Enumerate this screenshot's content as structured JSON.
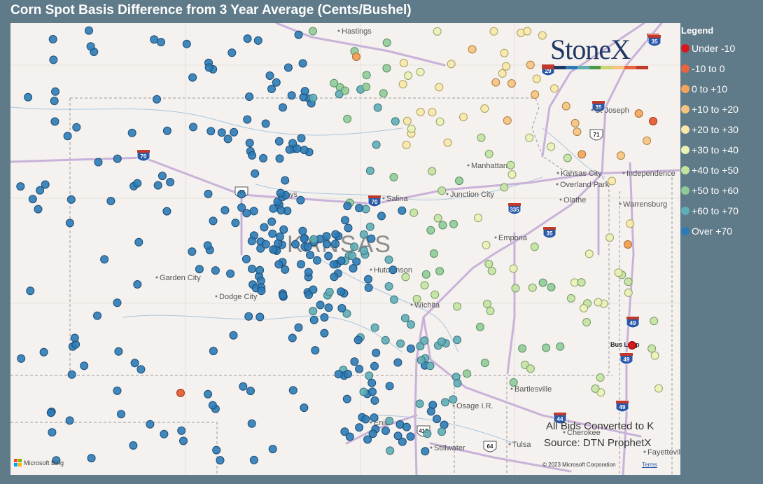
{
  "title": "Corn Spot Basis Difference from 3 Year Average (Cents/Bushel)",
  "legend": {
    "title": "Legend",
    "items": [
      {
        "label": "Under -10",
        "color": "#d7191c"
      },
      {
        "label": "-10 to 0",
        "color": "#e8643c"
      },
      {
        "label": "0 to +10",
        "color": "#f4a45a"
      },
      {
        "label": "+10 to +20",
        "color": "#f7c37e"
      },
      {
        "label": "+20 to +30",
        "color": "#fae8a8"
      },
      {
        "label": "+30 to +40",
        "color": "#eaf2b4"
      },
      {
        "label": "+40 to +50",
        "color": "#c4e3a0"
      },
      {
        "label": "+50 to +60",
        "color": "#8fcb98"
      },
      {
        "label": "+60 to +70",
        "color": "#5fadb5"
      },
      {
        "label": "Over +70",
        "color": "#2c7bb6"
      }
    ]
  },
  "logo": {
    "text": "StoneX",
    "bar_colors": [
      "#c0392b",
      "#1f3864",
      "#2c7bb6",
      "#5fadb5",
      "#4a9a4a",
      "#c7d66f",
      "#f7c37e",
      "#e8643c",
      "#c0392b"
    ]
  },
  "state_label": "KANSAS",
  "cities": [
    {
      "name": "Hays"
    },
    {
      "name": "Salina"
    },
    {
      "name": "Junction City"
    },
    {
      "name": "Manhattan"
    },
    {
      "name": "Kansas City"
    },
    {
      "name": "Overland Park"
    },
    {
      "name": "Olathe"
    },
    {
      "name": "Independence"
    },
    {
      "name": "Warrensburg"
    },
    {
      "name": "St Joseph"
    },
    {
      "name": "Emporia"
    },
    {
      "name": "Hutchinson"
    },
    {
      "name": "Wichita"
    },
    {
      "name": "Garden City"
    },
    {
      "name": "Dodge City"
    },
    {
      "name": "Enid"
    },
    {
      "name": "Stillwater"
    },
    {
      "name": "Tulsa"
    },
    {
      "name": "Bartlesville"
    },
    {
      "name": "Osage I.R."
    },
    {
      "name": "Cherokee"
    },
    {
      "name": "Fayetteville"
    },
    {
      "name": "Hastings"
    },
    {
      "name": "Bus Loop"
    }
  ],
  "highways": [
    "70",
    "70",
    "70",
    "35",
    "35",
    "35",
    "335",
    "29",
    "71",
    "40",
    "49",
    "49",
    "49",
    "412",
    "64",
    "44"
  ],
  "notes": {
    "line1": "All Bids Converted to K",
    "line2": "Source: DTN ProphetX"
  },
  "attribution": {
    "bing": "Microsoft Bing",
    "copyright": "© 2023 Microsoft Corporation",
    "terms": "Terms"
  }
}
